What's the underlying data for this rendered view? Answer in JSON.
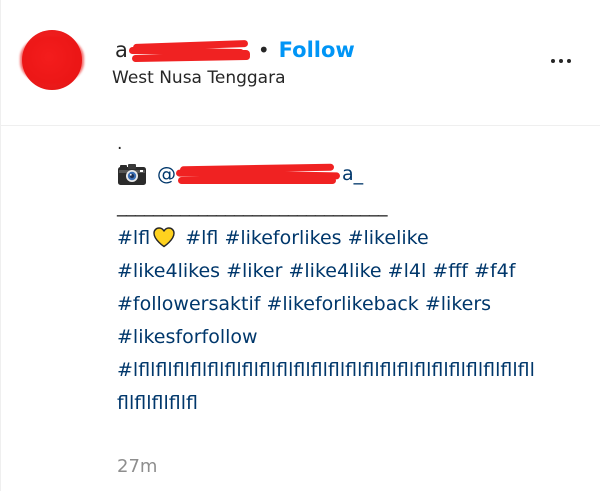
{
  "header": {
    "username_visible_start": "a",
    "username_visible_end": "",
    "separator": "•",
    "follow_label": "Follow",
    "location": "West Nusa Tenggara"
  },
  "caption": {
    "period": ".",
    "mention_prefix": "@",
    "mention_suffix": "a_",
    "underscore_line": "______________________________",
    "lines": [
      [
        {
          "text": "#lfl",
          "heart": true
        },
        {
          "text": "#lfl"
        },
        {
          "text": "#likeforlikes"
        },
        {
          "text": "#likelike"
        }
      ],
      [
        {
          "text": "#like4likes"
        },
        {
          "text": "#liker"
        },
        {
          "text": "#like4like"
        },
        {
          "text": "#l4l"
        },
        {
          "text": "#fff"
        },
        {
          "text": "#f4f"
        }
      ],
      [
        {
          "text": "#followersaktif"
        },
        {
          "text": "#likeforlikeback"
        },
        {
          "text": "#likers"
        }
      ],
      [
        {
          "text": "#likesforfollow"
        }
      ],
      [
        {
          "text": "#lfllfllfllfllfllfllfllfllfllfllfllfllfllfllfllfllfllfllfllfllfllfllfll"
        }
      ],
      [
        {
          "text": "fllfllfllfllfl"
        }
      ]
    ]
  },
  "timestamp": "27m",
  "icons": {
    "more": "more-options-icon",
    "camera": "camera-emoji-icon",
    "heart": "yellow-heart-emoji-icon"
  },
  "colors": {
    "follow": "#0095f6",
    "hashtag": "#00376b",
    "text": "#262626",
    "muted": "#8e8e8e",
    "redaction": "#f02222",
    "heart": "#ffd21f"
  }
}
